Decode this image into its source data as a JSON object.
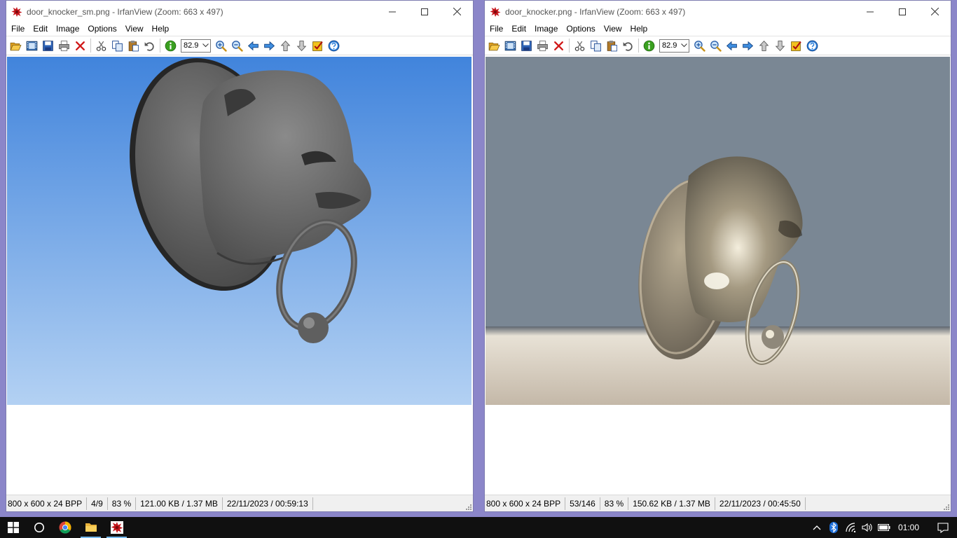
{
  "windows": [
    {
      "id": "left",
      "title": "door_knocker_sm.png - IrfanView (Zoom: 663 x 497)",
      "menu": [
        "File",
        "Edit",
        "Image",
        "Options",
        "View",
        "Help"
      ],
      "zoom_value": "82.9",
      "status": {
        "dimensions": "800 x 600 x 24 BPP",
        "index": "4/9",
        "zoom": "83 %",
        "size": "121.00 KB / 1.37 MB",
        "datetime": "22/11/2023 / 00:59:13"
      }
    },
    {
      "id": "right",
      "title": "door_knocker.png - IrfanView (Zoom: 663 x 497)",
      "menu": [
        "File",
        "Edit",
        "Image",
        "Options",
        "View",
        "Help"
      ],
      "zoom_value": "82.9",
      "status": {
        "dimensions": "800 x 600 x 24 BPP",
        "index": "53/146",
        "zoom": "83 %",
        "size": "150.62 KB / 1.37 MB",
        "datetime": "22/11/2023 / 00:45:50"
      }
    }
  ],
  "toolbar_icons": [
    "open-icon",
    "slideshow-icon",
    "save-icon",
    "print-icon",
    "delete-icon",
    "cut-icon",
    "copy-icon",
    "paste-icon",
    "undo-icon",
    "info-icon",
    "zoom-in-icon",
    "zoom-out-icon",
    "previous-icon",
    "next-icon",
    "first-icon",
    "last-icon",
    "settings-icon",
    "help-icon"
  ],
  "taskbar": {
    "clock": "01:00",
    "apps": [
      "start",
      "search",
      "chrome",
      "file-explorer",
      "irfanview"
    ]
  },
  "colors": {
    "desktop": "#8b86c9",
    "taskbar": "#101010",
    "sky_top": "#4184dc",
    "sky_bottom": "#b3d1f3",
    "studio_bg": "#7a8794"
  }
}
